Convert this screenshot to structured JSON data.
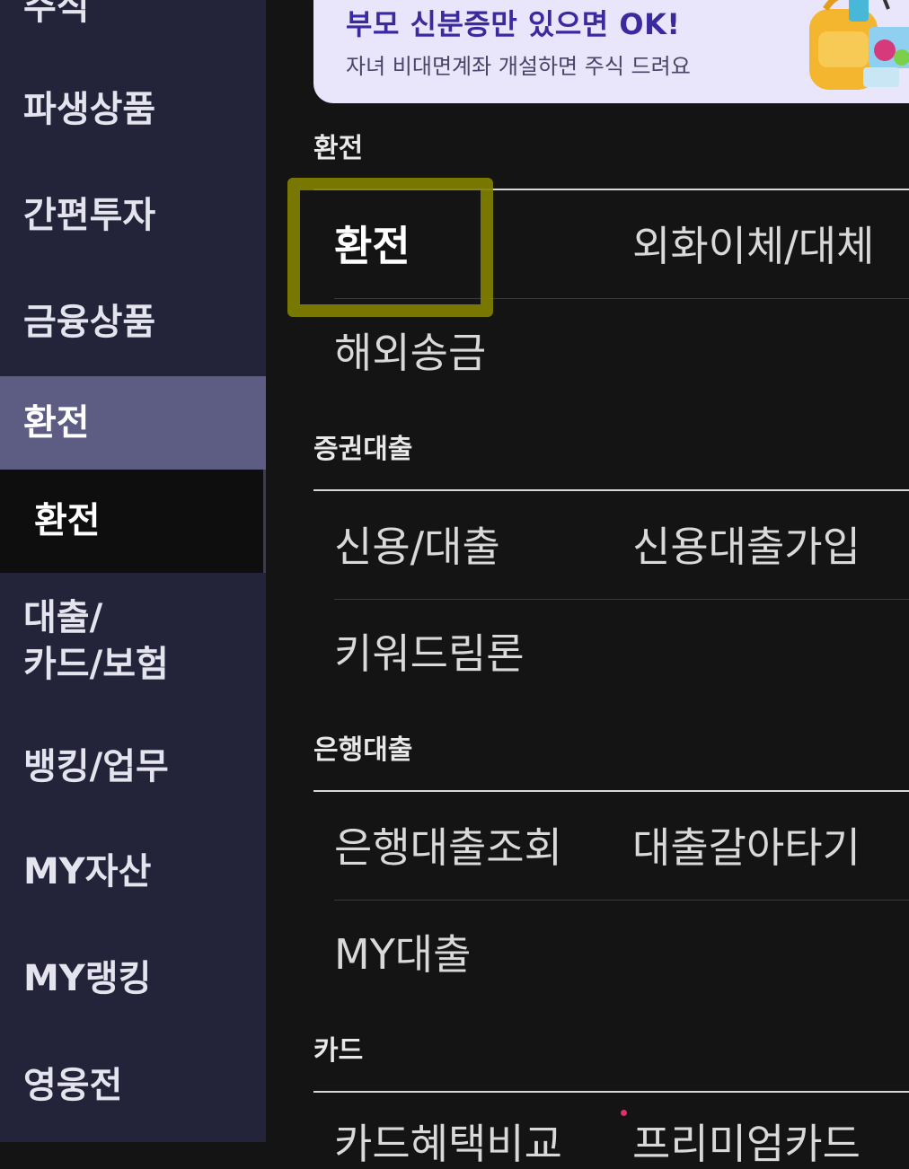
{
  "sidebar": {
    "top_partial": "주식",
    "items": [
      "파생상품",
      "간편투자",
      "금융상품"
    ],
    "active": "환전",
    "active_sub": "환전",
    "loan_line1": "대출/",
    "loan_line2": "카드/보험",
    "items_after": [
      "뱅킹/업무",
      "MY자산",
      "MY랭킹",
      "영웅전"
    ]
  },
  "banner": {
    "title": "부모 신분증만 있으면  OK!",
    "subtitle": "자녀 비대면계좌 개설하면 주식 드려요",
    "art_icon": "backpack-illustration-icon"
  },
  "sections": {
    "exchange": {
      "title": "환전",
      "links": [
        "환전",
        "외화이체/대체",
        "해외송금"
      ]
    },
    "sec_loan": {
      "title": "증권대출",
      "links": [
        "신용/대출",
        "신용대출가입",
        "키워드림론"
      ]
    },
    "bank_loan": {
      "title": "은행대출",
      "links": [
        "은행대출조회",
        "대출갈아타기",
        "MY대출"
      ]
    },
    "card": {
      "title": "카드",
      "links": [
        "카드혜택비교",
        "프리미엄카드"
      ]
    }
  },
  "colors": {
    "sidebar_bg": "#23233a",
    "sidebar_active": "#5d5d84",
    "highlight_border": "#808000",
    "banner_bg": "#e9e6fb",
    "notification_dot": "#e0306a"
  }
}
